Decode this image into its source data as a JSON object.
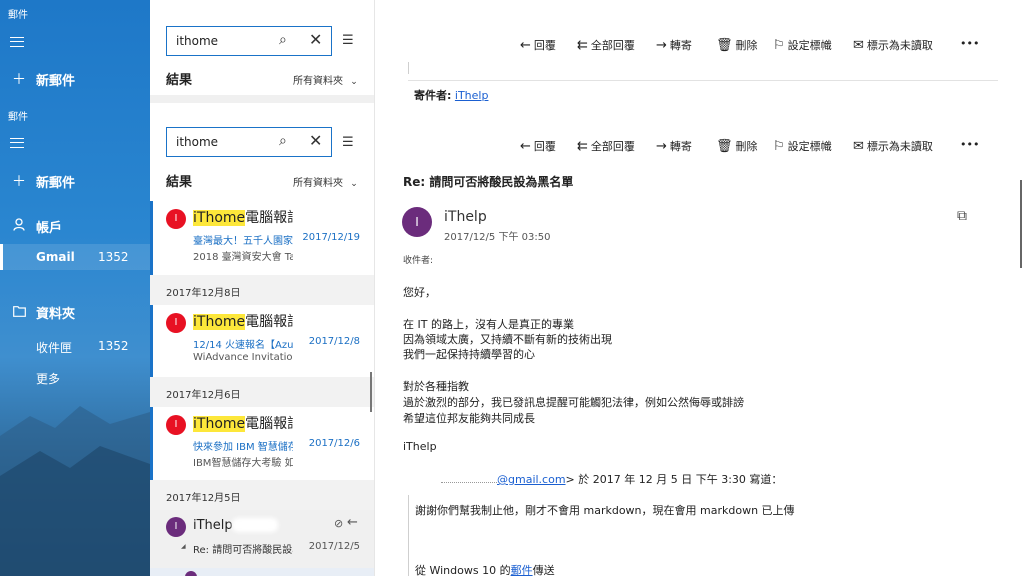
{
  "nav": {
    "app_name_top": "郵件",
    "new_mail_top": "新郵件",
    "app_name": "郵件",
    "new_mail": "新郵件",
    "accounts_label": "帳戶",
    "account_name": "Gmail",
    "account_count": "1352",
    "folders_label": "資料夾",
    "inbox_label": "收件匣",
    "inbox_count": "1352",
    "more_label": "更多"
  },
  "list": {
    "search_value_top": "ithome",
    "results_label_top": "結果",
    "scope_top": "所有資料夾",
    "search_value": "ithome",
    "results_label": "結果",
    "scope": "所有資料夾",
    "date_headers": [
      "2017年12月8日",
      "2017年12月6日",
      "2017年12月5日"
    ],
    "messages": [
      {
        "avatar": "I",
        "sender_hl": "iThome",
        "sender_rest": "電腦報訊",
        "subject": "臺灣最大！五千人園家",
        "date": "2017/12/19",
        "preview": "2018 臺灣資安大會 Ta"
      },
      {
        "avatar": "I",
        "sender_hl": "iThome",
        "sender_rest": "電腦報訊",
        "subject": "12/14 火速報名【Azure",
        "date": "2017/12/8",
        "preview": "WiAdvance Invitation $"
      },
      {
        "avatar": "I",
        "sender_hl": "iThome",
        "sender_rest": "電腦報訊",
        "subject": "快來參加 IBM 智慧儲存",
        "date": "2017/12/6",
        "preview": "IBM智慧儲存大考驗 如"
      },
      {
        "avatar": "I",
        "sender": "iThelp",
        "subject": "Re: 請問可否將酸民設為",
        "date": "2017/12/5",
        "reply_marker": "◢"
      }
    ]
  },
  "reading": {
    "toolbar": {
      "reply": "回覆",
      "reply_all": "全部回覆",
      "forward": "轉寄",
      "delete": "刪除",
      "flag": "設定標幟",
      "mark_unread": "標示為未讀取",
      "more": "•••"
    },
    "prev_sender_label": "寄件者:",
    "prev_sender_name": "iThelp",
    "subject": "Re: 請問可否將酸民設為黑名單",
    "from_avatar": "I",
    "from_name": "iThelp",
    "from_time": "2017/12/5 下午 03:50",
    "to_label": "收件者:",
    "body": {
      "greeting": "您好，",
      "p1_l1": "在 IT 的路上，沒有人是真正的專業",
      "p1_l2": "因為領域太廣，又持續不斷有新的技術出現",
      "p1_l3": "我們一起保持持續學習的心",
      "p2_l1": "對於各種指教",
      "p2_l2": "過於激烈的部分，我已發訊息提醒可能觸犯法律，例如公然侮辱或誹謗",
      "p2_l3": "希望這位邦友能夠共同成長",
      "signature": "iThelp",
      "quote_email": "@gmail.com",
      "quote_suffix": "> 於 2017 年 12 月 5 日 下午 3:30 寫道：",
      "quote_l1": "謝謝你們幫我制止他，剛才不會用 markdown，現在會用 markdown 已上傳",
      "footer_prefix": "從 Windows 10 的",
      "footer_link": "郵件",
      "footer_suffix": "傳送"
    }
  },
  "colors": {
    "accent": "#1a73c8",
    "highlight": "#fde73a",
    "avatar_red": "#e81123",
    "avatar_purple": "#6b2c7c"
  }
}
